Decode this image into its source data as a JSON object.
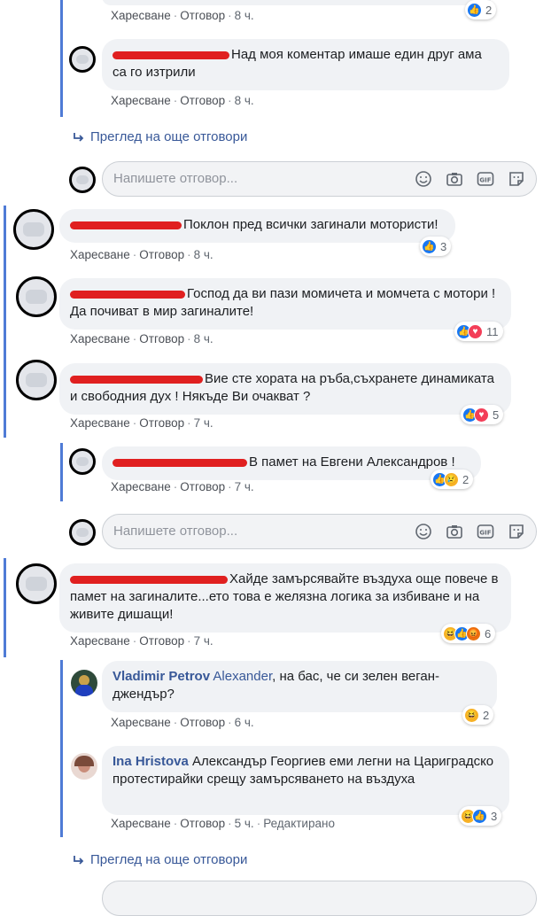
{
  "labels": {
    "like": "Харесване",
    "reply": "Отговор",
    "edited": "Редактирано"
  },
  "top_meta": {
    "time": "8 ч."
  },
  "top_reactions": {
    "count": "2"
  },
  "reply1": {
    "text": "Над моя коментар имаше един друг ама са го изтрили",
    "time": "8 ч."
  },
  "view_more_1": "Преглед на още отговори",
  "reply_box_1": {
    "placeholder": "Напишете отговор..."
  },
  "comment1": {
    "text": "Поклон пред всички загинали мотористи!",
    "time": "8 ч.",
    "reactions": "3"
  },
  "comment2": {
    "text": "Господ да ви пази момичета и момчета с мотори ! Да почиват в мир загиналите!",
    "time": "8 ч.",
    "reactions": "11"
  },
  "comment3": {
    "text": "Вие сте хората на ръба,съхранете динамиката и свободния дух ! Някъде Ви очакват ?",
    "time": "7 ч.",
    "reactions": "5"
  },
  "reply2": {
    "text": "В памет на Евгени Александров !",
    "time": "7 ч.",
    "reactions": "2"
  },
  "reply_box_2": {
    "placeholder": "Напишете отговор..."
  },
  "comment4": {
    "text": "Хайде замърсявайте въздуха още повече в памет на загиналите...ето това е желязна логика за избиване и на живите дишащи!",
    "time": "7 ч.",
    "reactions": "6"
  },
  "reply3": {
    "author": "Vladimir Petrov",
    "tag": "Alexander",
    "text": ", на бас, че си зелен веган-джендър?",
    "time": "6 ч.",
    "reactions": "2"
  },
  "reply4": {
    "author": "Ina Hristova",
    "text": "Александър Георгиев еми легни на Цариградско протестирайки срещу замърсяването на въздуха",
    "time": "5 ч.",
    "reactions": "3"
  },
  "view_more_2": "Преглед на още отговори",
  "icons": [
    "emoji-icon",
    "camera-icon",
    "gif-icon",
    "sticker-icon"
  ]
}
